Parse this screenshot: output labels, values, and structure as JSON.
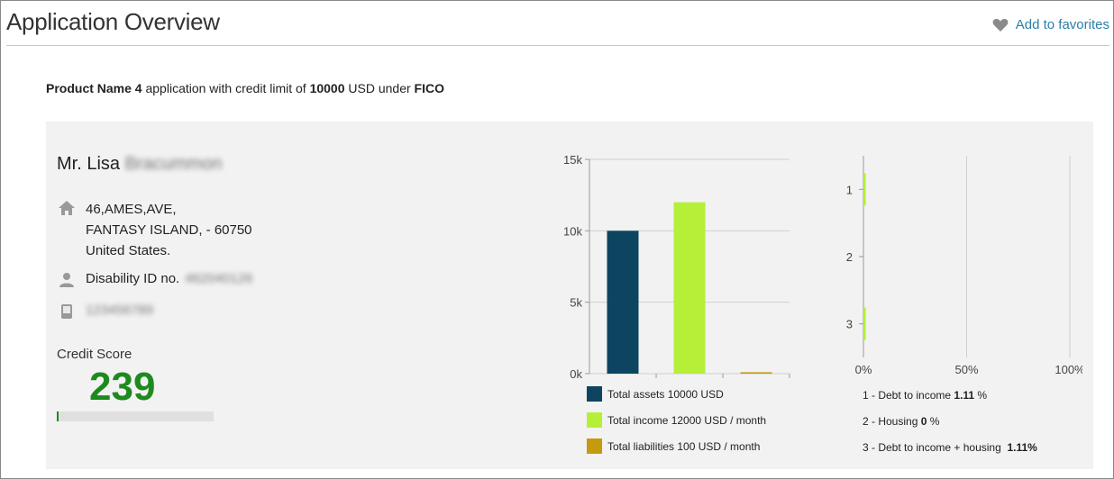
{
  "header": {
    "title": "Application Overview",
    "favorites_label": "Add to favorites"
  },
  "summary": {
    "product": "Product Name 4",
    "text1": " application with credit limit of ",
    "limit": "10000",
    "text2": " USD under ",
    "bureau": "FICO"
  },
  "applicant": {
    "salutation_first": "Mr. Lisa",
    "last_name_redacted": "Bracummon",
    "address_line1": "46,AMES,AVE,",
    "address_line2": "FANTASY ISLAND, - 60750",
    "address_line3": "United States.",
    "id_label": "Disability ID no.",
    "id_value_redacted": "462040126",
    "phone_redacted": "123456789"
  },
  "credit": {
    "label": "Credit Score",
    "score": "239",
    "bar_fraction": 0.01,
    "color": "#1e8a1e"
  },
  "colors": {
    "assets": "#0d4560",
    "income": "#b6ef37",
    "liabilities": "#c59a0c",
    "ratio": "#b6ef37",
    "link": "#2a7fa8"
  },
  "icons": {
    "favorites": "heart-icon",
    "address": "home-icon",
    "id": "person-icon",
    "phone": "phone-icon"
  },
  "chart_data": [
    {
      "type": "bar",
      "categories": [
        "Total assets",
        "Total income",
        "Total liabilities"
      ],
      "values": [
        10000,
        12000,
        100
      ],
      "ylim": [
        0,
        15000
      ],
      "yticks": [
        0,
        5000,
        10000,
        15000
      ],
      "ytick_labels": [
        "0k",
        "5k",
        "10k",
        "15k"
      ],
      "grid": true,
      "legend": [
        "Total assets 10000 USD",
        "Total income 12000 USD  / month",
        "Total liabilities 100 USD  / month"
      ],
      "legend_placement": "bottom"
    },
    {
      "type": "bar",
      "orientation": "horizontal",
      "categories": [
        "1",
        "2",
        "3"
      ],
      "values": [
        1.11,
        0,
        1.11
      ],
      "xlim": [
        0,
        100
      ],
      "xticks": [
        0,
        50,
        100
      ],
      "xtick_labels": [
        "0%",
        "50%",
        "100%"
      ],
      "grid": true,
      "legend": [
        {
          "prefix": "1 - Debt to income ",
          "value": "1.11",
          "suffix": " %"
        },
        {
          "prefix": "2 - Housing ",
          "value": "0",
          "suffix": " %"
        },
        {
          "prefix": "3 - Debt to income + housing  ",
          "value": "1.11%",
          "suffix": ""
        }
      ],
      "legend_placement": "bottom"
    }
  ]
}
